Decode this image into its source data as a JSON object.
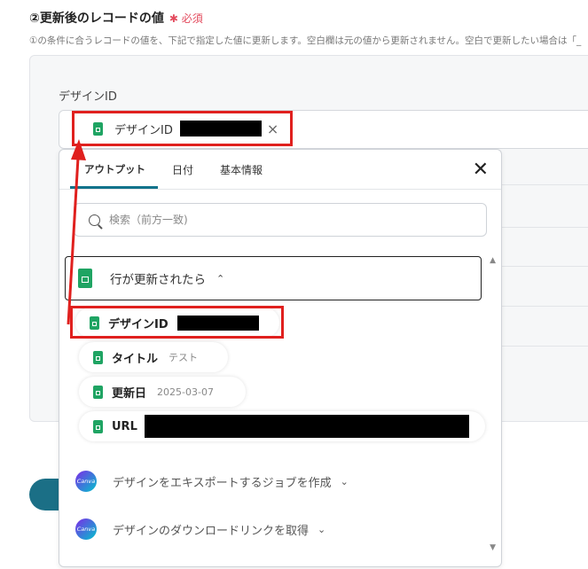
{
  "section": {
    "title": "②更新後のレコードの値",
    "required": "✱ 必須",
    "description": "①の条件に合うレコードの値を、下記で指定した値に更新します。空白欄は元の値から更新されません。空白で更新したい場合は「_"
  },
  "field": {
    "label": "デザインID",
    "chip_label": "デザインID",
    "remove_icon": "×"
  },
  "dropdown": {
    "tabs": [
      "アウトプット",
      "日付",
      "基本情報"
    ],
    "active_tab": "アウトプット",
    "close_icon": "✕",
    "search_placeholder": "検索（前方一致)",
    "group": {
      "label": "行が更新されたら",
      "chevron": "⌃",
      "items": [
        {
          "label": "デザインID",
          "value": ""
        },
        {
          "label": "タイトル",
          "value": "テスト"
        },
        {
          "label": "更新日",
          "value": "2025-03-07"
        },
        {
          "label": "URL",
          "value": ""
        }
      ]
    },
    "canva_actions": [
      {
        "logo_text": "Canva",
        "label": "デザインをエキスポートするジョブを作成",
        "chevron": "⌄"
      },
      {
        "logo_text": "Canva",
        "label": "デザインのダウンロードリンクを取得",
        "chevron": "⌄"
      }
    ]
  },
  "colors": {
    "accent": "#12738b",
    "highlight": "#e0201e",
    "sheets_green": "#1fa463"
  }
}
